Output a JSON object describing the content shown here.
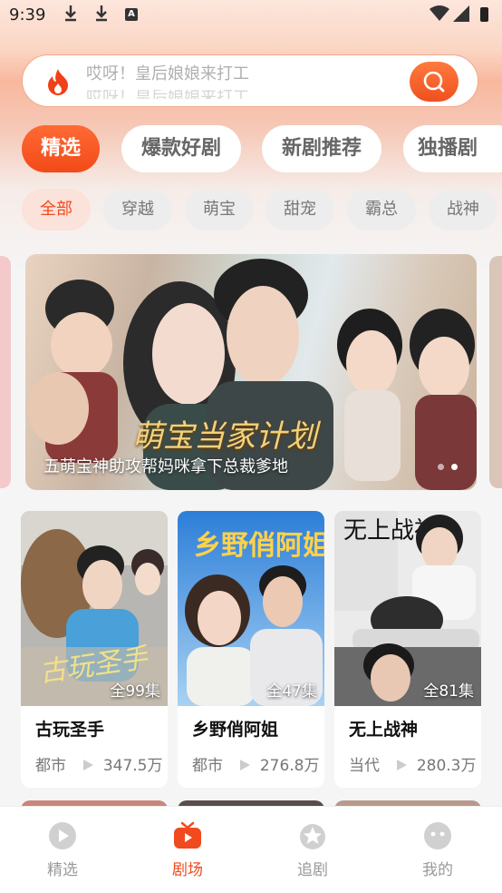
{
  "status_bar": {
    "time": "9:39",
    "a_badge": "A"
  },
  "search": {
    "placeholder": "哎呀！皇后娘娘来打工"
  },
  "tabs": [
    {
      "label": "精选",
      "active": true
    },
    {
      "label": "爆款好剧",
      "active": false
    },
    {
      "label": "新剧推荐",
      "active": false
    },
    {
      "label": "独播剧",
      "active": false
    }
  ],
  "categories": [
    {
      "label": "全部",
      "active": true
    },
    {
      "label": "穿越",
      "active": false
    },
    {
      "label": "萌宝",
      "active": false
    },
    {
      "label": "甜宠",
      "active": false
    },
    {
      "label": "霸总",
      "active": false
    },
    {
      "label": "战神",
      "active": false
    }
  ],
  "banner": {
    "caption": "五萌宝神助攻帮妈咪拿下总裁爹地",
    "title_art": "萌宝当家计划",
    "dots": 2,
    "active_dot": 1
  },
  "dramas": [
    {
      "title": "古玩圣手",
      "episodes": "全99集",
      "genre": "都市",
      "views": "347.5万",
      "poster_text": "古玩圣手"
    },
    {
      "title": "乡野俏阿姐",
      "episodes": "全47集",
      "genre": "都市",
      "views": "276.8万",
      "poster_text": "乡野俏阿姐"
    },
    {
      "title": "无上战神",
      "episodes": "全81集",
      "genre": "当代",
      "views": "280.3万",
      "poster_text": "无上战神"
    }
  ],
  "bottom_nav": [
    {
      "label": "精选",
      "icon": "play-circle-icon",
      "active": false
    },
    {
      "label": "剧场",
      "icon": "tv-icon",
      "active": true
    },
    {
      "label": "追剧",
      "icon": "star-icon",
      "active": false
    },
    {
      "label": "我的",
      "icon": "face-icon",
      "active": false
    }
  ],
  "colors": {
    "accent": "#f04a1e",
    "accent_light": "#fbe2da"
  }
}
